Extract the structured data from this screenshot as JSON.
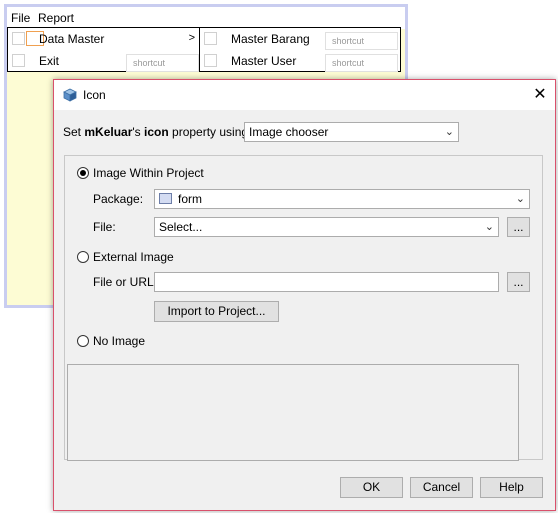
{
  "menubar": {
    "file": "File",
    "report": "Report"
  },
  "file_menu": {
    "data_master": "Data Master",
    "exit": "Exit",
    "exit_shortcut": "shortcut",
    "submenu_arrow": ">"
  },
  "sub_menu": {
    "master_barang": "Master Barang",
    "master_barang_shortcut": "shortcut",
    "master_user": "Master User",
    "master_user_shortcut": "shortcut"
  },
  "dialog": {
    "title": "Icon",
    "title_icon": "cube-icon",
    "close": "✕",
    "set_prefix": "Set ",
    "set_component": "mKeluar",
    "set_possessive": "'s ",
    "set_property": "icon",
    "set_suffix": " property using:",
    "mode_value": "Image chooser",
    "image_within_project": "Image Within Project",
    "package_label": "Package:",
    "package_value": "form",
    "file_label": "File:",
    "file_value": "Select...",
    "browse": "...",
    "external_image": "External Image",
    "file_url_label": "File or URL:",
    "file_url_value": "",
    "import_button": "Import to Project...",
    "no_image": "No Image",
    "ok": "OK",
    "cancel": "Cancel",
    "help": "Help"
  },
  "colors": {
    "dialog_border": "#d9506b",
    "design_background": "#fdfcd4",
    "design_frame": "#c9cdf0"
  }
}
